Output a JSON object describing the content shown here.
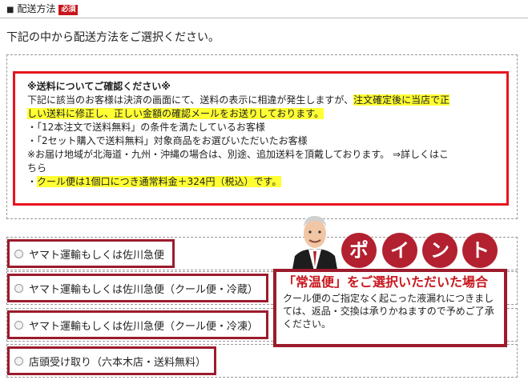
{
  "section": {
    "title": "配送方法",
    "required_badge": "必須"
  },
  "intro_text": "下記の中から配送方法をご選択ください。",
  "notice": {
    "title": "※送料についてご確認ください※",
    "line1": "下記に該当のお客様は決済の画面にて、送料の表示に相違が発生しますが、",
    "line1_hl": "注文確定後に当店で正",
    "line2_hl": "しい送料に修正し、正しい金額の確認メールをお送りしております。",
    "bullet1": "・「12本注文で送料無料」の条件を満たしているお客様",
    "bullet2": "・「2セット購入で送料無料」対象商品をお選びいただいたお客様",
    "line3": "※お届け地域が北海道・九州・沖縄の場合は、別途、追加送料を頂戴しております。 ⇒詳しくはこ",
    "line4": "ちら",
    "bullet3_prefix": "・",
    "bullet3_hl": "クール便は1個口につき通常料金＋324円（税込）です。"
  },
  "options": [
    "ヤマト運輸もしくは佐川急便",
    "ヤマト運輸もしくは佐川急便（クール便・冷蔵）",
    "ヤマト運輸もしくは佐川急便（クール便・冷凍）",
    "店頭受け取り（六本木店・送料無料）"
  ],
  "point": {
    "badges": [
      "ポ",
      "イ",
      "ン",
      "ト"
    ],
    "title": "「常温便」をご選択いただいた場合",
    "body": "クール便のご指定なく起こった液漏れにつきましては、返品・交換は承りかねますので予めご了承ください。"
  },
  "colors": {
    "accent": "#9c1b2c",
    "alert": "#e8151d",
    "highlight": "#ffff33"
  }
}
